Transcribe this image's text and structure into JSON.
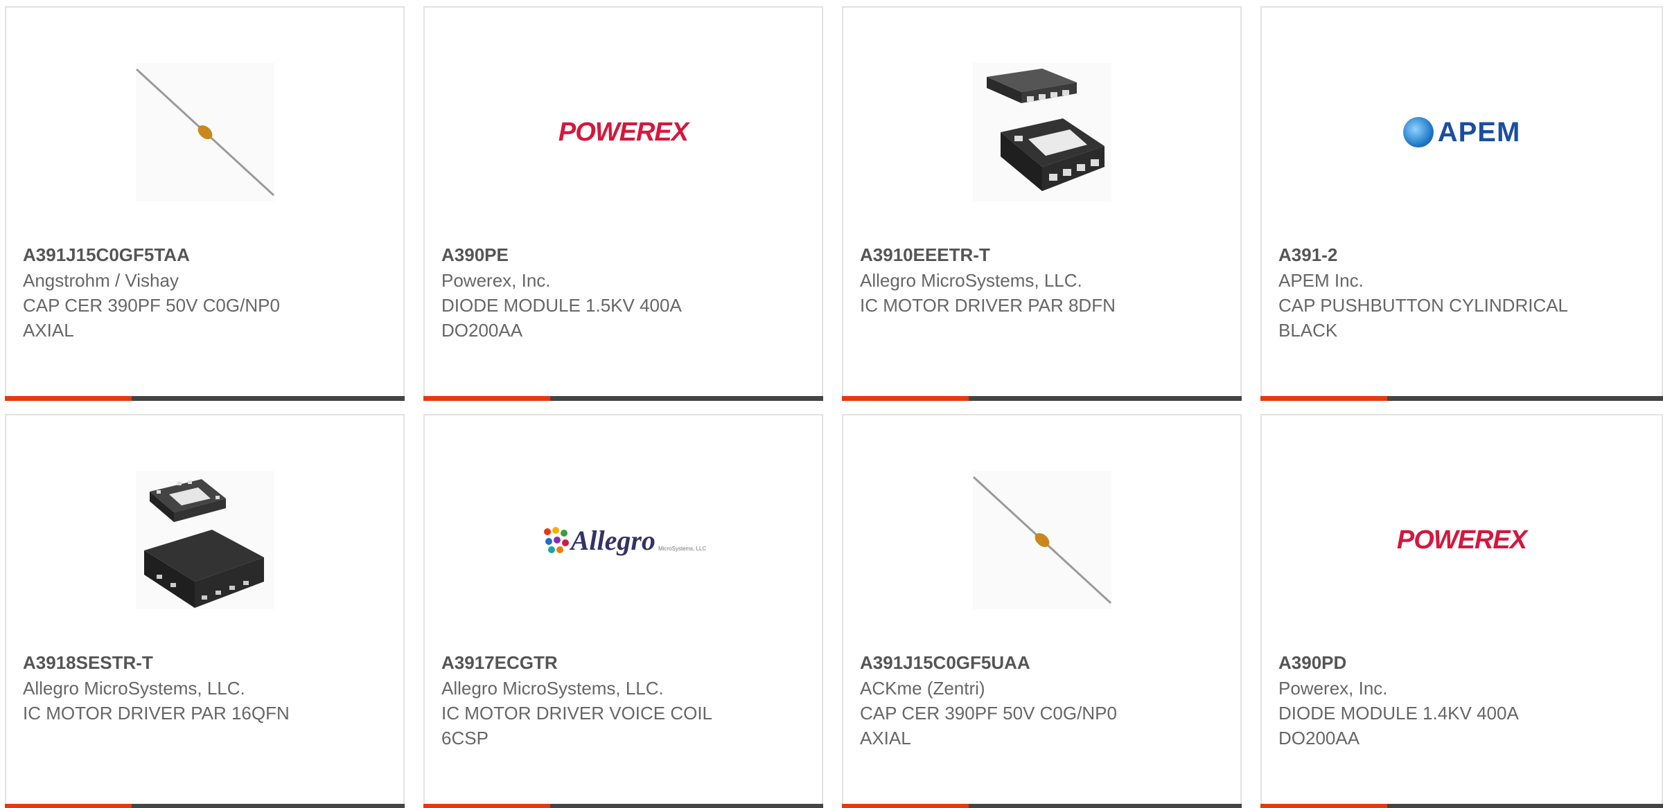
{
  "products": [
    {
      "part": "A391J15C0GF5TAA",
      "manufacturer": "Angstrohm / Vishay",
      "description": "CAP CER 390PF 50V C0G/NP0 AXIAL",
      "image": "axial-capacitor-photo"
    },
    {
      "part": "A390PE",
      "manufacturer": "Powerex, Inc.",
      "description": "DIODE MODULE 1.5KV 400A DO200AA",
      "image": "powerex-logo",
      "logo_text": "POWEREX"
    },
    {
      "part": "A3910EEETR-T",
      "manufacturer": "Allegro MicroSystems, LLC.",
      "description": "IC MOTOR DRIVER PAR 8DFN",
      "image": "dfn8-package-photo"
    },
    {
      "part": "A391-2",
      "manufacturer": "APEM Inc.",
      "description": "CAP PUSHBUTTON CYLINDRICAL BLACK",
      "image": "apem-logo",
      "logo_text": "APEM"
    },
    {
      "part": "A3918SESTR-T",
      "manufacturer": "Allegro MicroSystems, LLC.",
      "description": "IC MOTOR DRIVER PAR 16QFN",
      "image": "qfn16-package-photo"
    },
    {
      "part": "A3917ECGTR",
      "manufacturer": "Allegro MicroSystems, LLC.",
      "description": "IC MOTOR DRIVER VOICE COIL 6CSP",
      "image": "allegro-logo",
      "logo_text": "Allegro",
      "logo_subtext": "MicroSystems, LLC"
    },
    {
      "part": "A391J15C0GF5UAA",
      "manufacturer": "ACKme (Zentri)",
      "description": "CAP CER 390PF 50V C0G/NP0 AXIAL",
      "image": "axial-capacitor-photo"
    },
    {
      "part": "A390PD",
      "manufacturer": "Powerex, Inc.",
      "description": "DIODE MODULE 1.4KV 400A DO200AA",
      "image": "powerex-logo",
      "logo_text": "POWEREX"
    }
  ],
  "colors": {
    "accent": "#e8380d",
    "bar": "#444444",
    "border": "#e2e2e2",
    "powerex": "#d4183d",
    "apem": "#1a4f9e"
  }
}
